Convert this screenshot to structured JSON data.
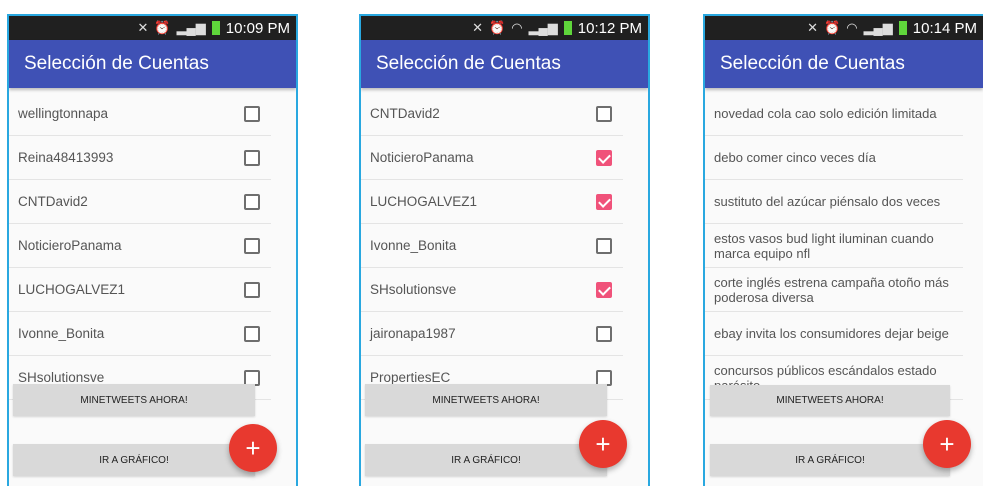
{
  "app": {
    "title": "Selección de Cuentas",
    "minetweets_label": "MINETWEETS AHORA!",
    "grafico_label": "IR A GRÁFICO!",
    "fab_symbol": "+"
  },
  "colors": {
    "appbar": "#3f51b5",
    "checked": "#f0527a",
    "fab": "#e8392f",
    "frame": "#29a8e0"
  },
  "screens": [
    {
      "time": "10:09 PM",
      "accounts": [
        {
          "name": "wellingtonnapa",
          "checked": false
        },
        {
          "name": "Reina48413993",
          "checked": false
        },
        {
          "name": "CNTDavid2",
          "checked": false
        },
        {
          "name": "NoticieroPanama",
          "checked": false
        },
        {
          "name": "LUCHOGALVEZ1",
          "checked": false
        },
        {
          "name": "Ivonne_Bonita",
          "checked": false
        },
        {
          "name": "SHsolutionsve",
          "checked": false
        }
      ]
    },
    {
      "time": "10:12 PM",
      "accounts": [
        {
          "name": "CNTDavid2",
          "checked": false
        },
        {
          "name": "NoticieroPanama",
          "checked": true
        },
        {
          "name": "LUCHOGALVEZ1",
          "checked": true
        },
        {
          "name": "Ivonne_Bonita",
          "checked": false
        },
        {
          "name": "SHsolutionsve",
          "checked": true
        },
        {
          "name": "jaironapa1987",
          "checked": false
        },
        {
          "name": "PropertiesEC",
          "checked": false
        }
      ]
    },
    {
      "time": "10:14 PM",
      "topics": [
        "novedad cola cao solo edición limitada",
        "debo comer cinco veces día",
        "sustituto del azúcar piénsalo dos veces",
        "estos vasos bud light iluminan cuando marca equipo nfl",
        "corte inglés estrena campaña otoño más poderosa diversa",
        "ebay invita los consumidores dejar beige",
        "concursos públicos escándalos estado parásito"
      ]
    }
  ]
}
